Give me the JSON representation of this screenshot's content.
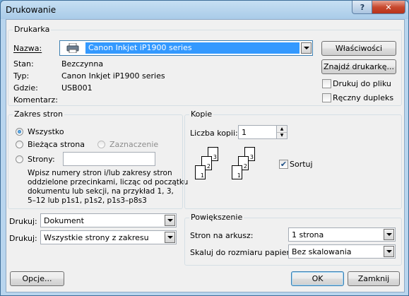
{
  "window": {
    "title": "Drukowanie",
    "help": "?",
    "close": "✕"
  },
  "printer": {
    "legend": "Drukarka",
    "name_label": "Nazwa:",
    "name_value": "Canon Inkjet iP1900 series",
    "status_label": "Stan:",
    "status_value": "Bezczynna",
    "type_label": "Typ:",
    "type_value": "Canon Inkjet iP1900 series",
    "where_label": "Gdzie:",
    "where_value": "USB001",
    "comment_label": "Komentarz:",
    "properties_button": "Właściwości",
    "find_button": "Znajdź drukarkę...",
    "print_to_file": "Drukuj do pliku",
    "manual_duplex": "Ręczny dupleks"
  },
  "range": {
    "legend": "Zakres stron",
    "all": "Wszystko",
    "current": "Bieżąca strona",
    "selection": "Zaznaczenie",
    "pages": "Strony:",
    "pages_value": "",
    "help_text": [
      "Wpisz numery stron i/lub zakresy stron",
      "oddzielone przecinkami, licząc od początku",
      "dokumentu lub sekcji, na przykład 1, 3,",
      "5–12 lub p1s1, p1s2, p1s3–p8s3"
    ]
  },
  "copies": {
    "legend": "Kopie",
    "count_label": "Liczba kopii:",
    "count_value": "1",
    "collate": "Sortuj",
    "collate_checked": true
  },
  "print_what": {
    "label": "Drukuj:",
    "value": "Dokument"
  },
  "print_which": {
    "label": "Drukuj:",
    "value": "Wszystkie strony z zakresu"
  },
  "zoom": {
    "legend": "Powiększenie",
    "per_sheet_label": "Stron na arkusz:",
    "per_sheet_value": "1 strona",
    "scale_label": "Skaluj do rozmiaru papieru:",
    "scale_value": "Bez skalowania"
  },
  "footer": {
    "options": "Opcje...",
    "ok": "OK",
    "cancel": "Zamknij"
  },
  "colors": {
    "selection_bg": "#3399ff",
    "title_glass": "#a9cbe8",
    "close_red": "#c84a2f"
  },
  "icons": {
    "printer": "printer-icon",
    "checkmark": "checkmark-icon",
    "dropdown": "chevron-down-icon"
  }
}
